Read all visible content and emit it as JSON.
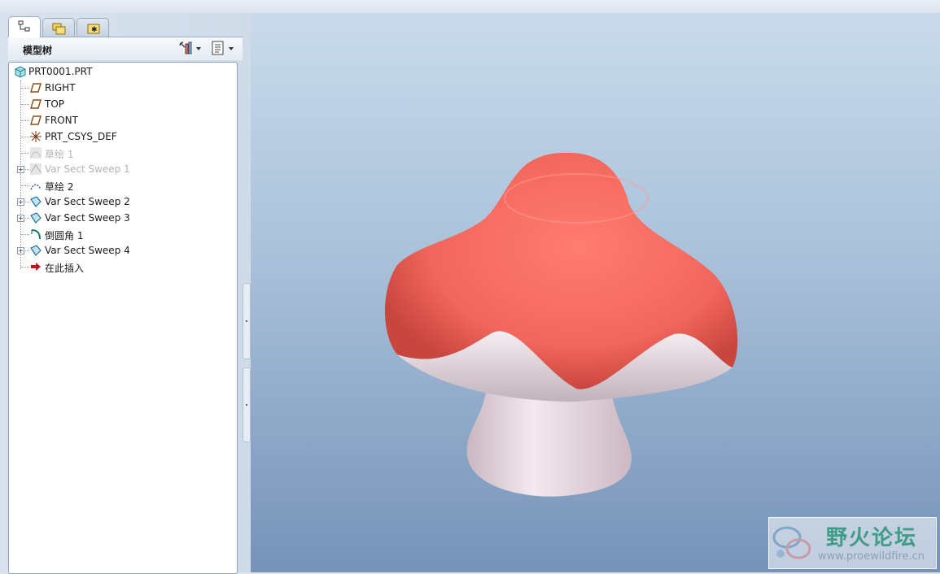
{
  "panel": {
    "tabs": [
      {
        "icon": "model-tree-icon"
      },
      {
        "icon": "folder-browser-icon"
      },
      {
        "icon": "favorites-icon"
      }
    ],
    "title": "模型树",
    "settings_icon": "settings-tools-icon",
    "show_icon": "show-columns-icon"
  },
  "tree": {
    "root": {
      "label": "PRT0001.PRT",
      "icon": "part-icon"
    },
    "items": [
      {
        "label": "RIGHT",
        "icon": "datum-plane-icon",
        "expandable": false,
        "suppressed": false
      },
      {
        "label": "TOP",
        "icon": "datum-plane-icon",
        "expandable": false,
        "suppressed": false
      },
      {
        "label": "FRONT",
        "icon": "datum-plane-icon",
        "expandable": false,
        "suppressed": false
      },
      {
        "label": "PRT_CSYS_DEF",
        "icon": "coordinate-system-icon",
        "expandable": false,
        "suppressed": false
      },
      {
        "label": "草绘 1",
        "icon": "sketch-icon",
        "expandable": false,
        "suppressed": true
      },
      {
        "label": "Var Sect Sweep 1",
        "icon": "sweep-icon",
        "expandable": true,
        "suppressed": true
      },
      {
        "label": "草绘 2",
        "icon": "sketch-icon",
        "expandable": false,
        "suppressed": false
      },
      {
        "label": "Var Sect Sweep 2",
        "icon": "sweep-icon",
        "expandable": true,
        "suppressed": false
      },
      {
        "label": "Var Sect Sweep 3",
        "icon": "sweep-icon",
        "expandable": true,
        "suppressed": false
      },
      {
        "label": "倒圆角 1",
        "icon": "round-icon",
        "expandable": false,
        "suppressed": false
      },
      {
        "label": "Var Sect Sweep 4",
        "icon": "sweep-icon",
        "expandable": true,
        "suppressed": false
      },
      {
        "label": "在此插入",
        "icon": "insert-here-arrow-icon",
        "expandable": false,
        "suppressed": false
      }
    ]
  },
  "viewport": {
    "model": "mushroom-3d-model",
    "colors": {
      "cap": "#f2665c",
      "stem": "#ecdde4",
      "bg_top": "#c9dbeb",
      "bg_bottom": "#7592b8"
    }
  },
  "watermark": {
    "text": "野火论坛",
    "url": "www.proewildfire.cn"
  }
}
